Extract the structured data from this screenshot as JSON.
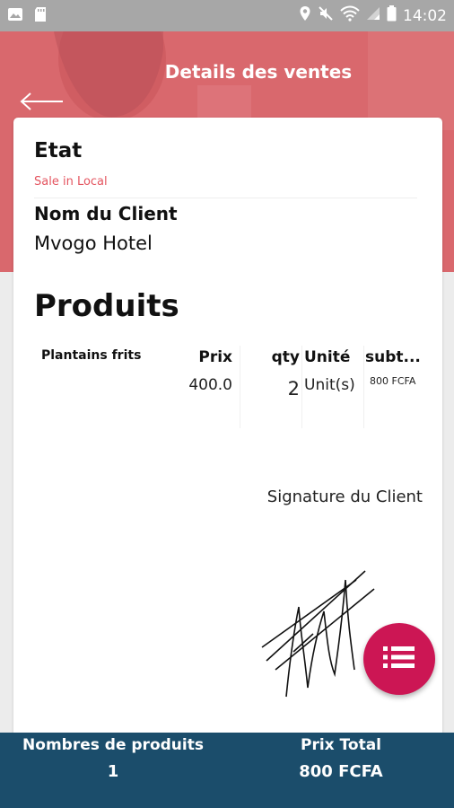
{
  "status_bar": {
    "time": "14:02",
    "left_icons": [
      "image-icon",
      "sd-card-icon"
    ],
    "right_icons": [
      "location-icon",
      "mute-icon",
      "wifi-icon",
      "signal-icon",
      "battery-icon"
    ]
  },
  "header": {
    "title": "Details des ventes",
    "back_icon": "arrow-left-icon",
    "background_color": "#d9686d"
  },
  "details": {
    "etat_label": "Etat",
    "etat_value": "Sale in Local",
    "client_label": "Nom du Client",
    "client_value": "Mvogo Hotel"
  },
  "products": {
    "title": "Produits",
    "columns": {
      "name": "Plantains frits",
      "prix": "Prix",
      "qty": "qty",
      "unit": "Unité",
      "subtotal": "subt..."
    },
    "rows": [
      {
        "prix": "400.0",
        "qty": "2",
        "unit": "Unit(s)",
        "subtotal": "800 FCFA"
      }
    ]
  },
  "signature": {
    "label": "Signature du Client"
  },
  "fab": {
    "icon": "list-icon",
    "color": "#cc1654"
  },
  "footer": {
    "count_label": "Nombres de produits",
    "count_value": "1",
    "total_label": "Prix Total",
    "total_value": "800 FCFA",
    "background_color": "#1b4d6b"
  },
  "colors": {
    "accent": "#e45560",
    "fab": "#cc1654",
    "footer": "#1b4d6b"
  }
}
